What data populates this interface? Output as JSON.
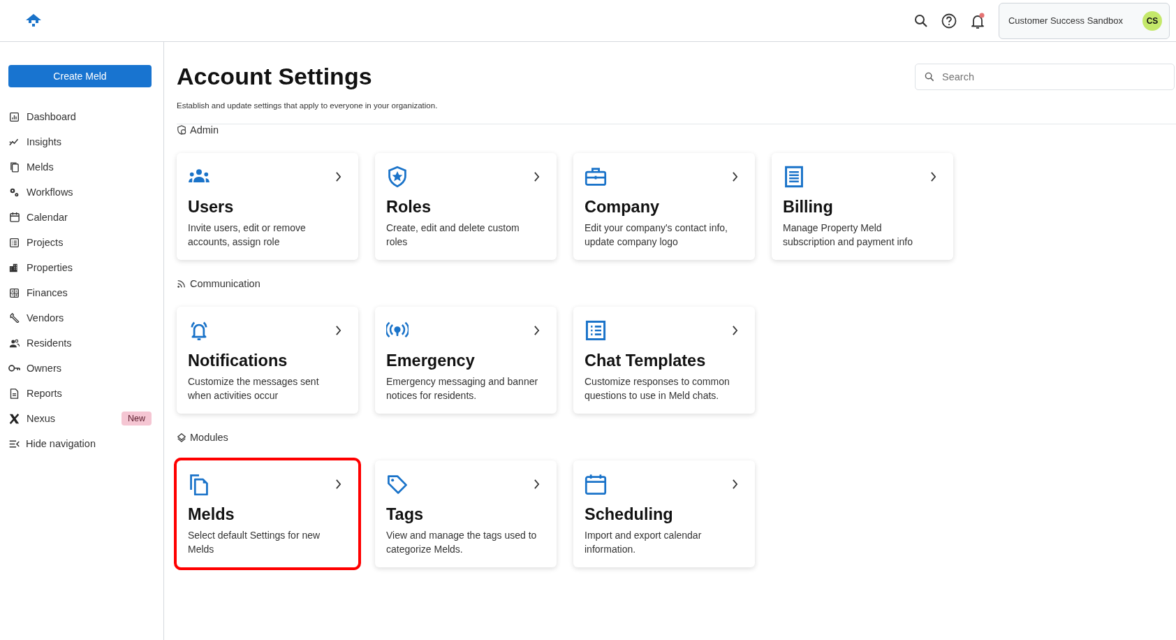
{
  "header": {
    "workspace": "Customer Success Sandbox",
    "avatar_initials": "CS",
    "notifications_unread": true
  },
  "sidebar": {
    "create_button": "Create Meld",
    "items": [
      {
        "label": "Dashboard"
      },
      {
        "label": "Insights"
      },
      {
        "label": "Melds"
      },
      {
        "label": "Workflows"
      },
      {
        "label": "Calendar"
      },
      {
        "label": "Projects"
      },
      {
        "label": "Properties"
      },
      {
        "label": "Finances"
      },
      {
        "label": "Vendors"
      },
      {
        "label": "Residents"
      },
      {
        "label": "Owners"
      },
      {
        "label": "Reports"
      },
      {
        "label": "Nexus",
        "badge": "New"
      }
    ],
    "hide_navigation": "Hide navigation"
  },
  "page": {
    "title": "Account Settings",
    "subtitle": "Establish and update settings that apply to everyone in your organization.",
    "search": {
      "placeholder": "Search"
    }
  },
  "sections": [
    {
      "title": "Admin",
      "cards": [
        {
          "title": "Users",
          "description": "Invite users, edit or remove accounts, assign role",
          "highlighted": false
        },
        {
          "title": "Roles",
          "description": "Create, edit and delete custom roles",
          "highlighted": false
        },
        {
          "title": "Company",
          "description": "Edit your company's contact info, update company logo",
          "highlighted": false
        },
        {
          "title": "Billing",
          "description": "Manage Property Meld subscription and payment info",
          "highlighted": false
        }
      ]
    },
    {
      "title": "Communication",
      "cards": [
        {
          "title": "Notifications",
          "description": "Customize the messages sent when activities occur",
          "highlighted": false
        },
        {
          "title": "Emergency",
          "description": "Emergency messaging and banner notices for residents.",
          "highlighted": false
        },
        {
          "title": "Chat Templates",
          "description": "Customize responses to common questions to use in Meld chats.",
          "highlighted": false
        }
      ]
    },
    {
      "title": "Modules",
      "cards": [
        {
          "title": "Melds",
          "description": "Select default Settings for new Melds",
          "highlighted": true
        },
        {
          "title": "Tags",
          "description": "View and manage the tags used to categorize Melds.",
          "highlighted": false
        },
        {
          "title": "Scheduling",
          "description": "Import and export calendar information.",
          "highlighted": false
        }
      ]
    }
  ]
}
